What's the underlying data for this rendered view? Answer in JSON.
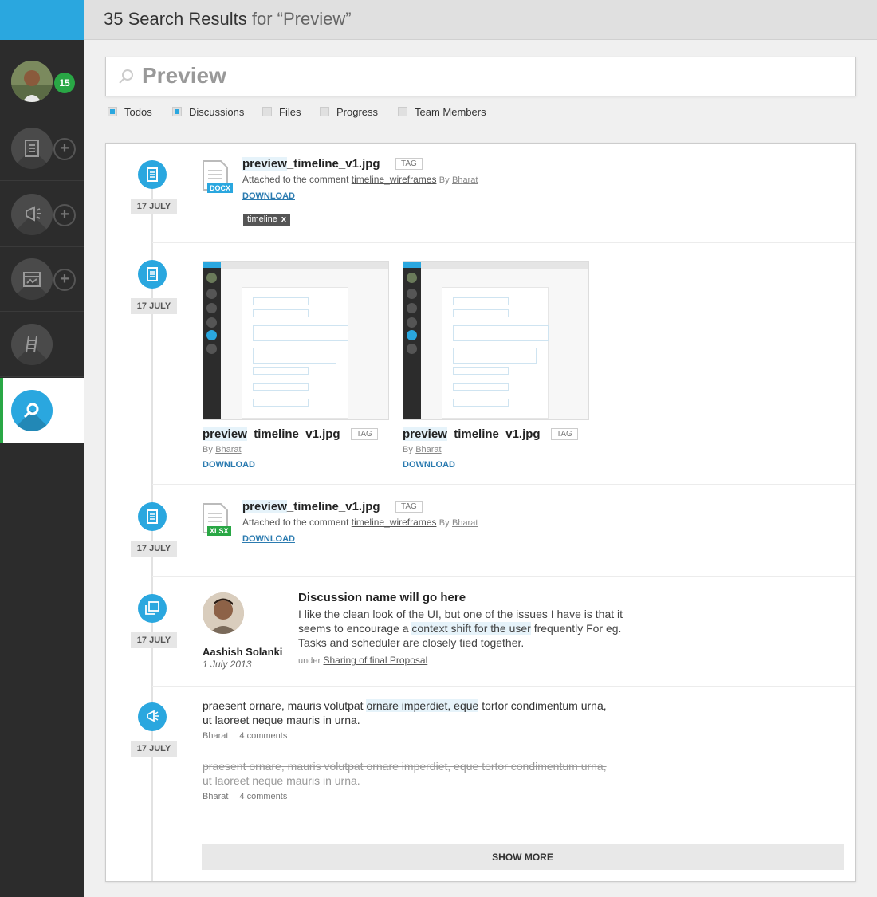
{
  "header": {
    "count_title": "35 Search Results",
    "query_suffix": "for “Preview”"
  },
  "nav": {
    "badge_count": "15"
  },
  "search": {
    "query": "Preview"
  },
  "filters": [
    {
      "label": "Todos",
      "checked": true
    },
    {
      "label": "Discussions",
      "checked": true
    },
    {
      "label": "Files",
      "checked": false
    },
    {
      "label": "Progress",
      "checked": false
    },
    {
      "label": "Team Members",
      "checked": false
    }
  ],
  "results": {
    "r1": {
      "date": "17 JULY",
      "file_name_hl": "preview",
      "file_name_rest": "_timeline_v1.jpg",
      "tag": "TAG",
      "attached_text": "Attached to the comment",
      "comment_link": "timeline_wireframes",
      "by": "By",
      "author": "Bharat",
      "download": "DOWNLOAD",
      "ext": "DOCX",
      "ext_color": "#2aa7df",
      "chip_label": "timeline",
      "chip_close": "x"
    },
    "r2": {
      "date": "17 JULY",
      "items": [
        {
          "file_name_hl": "preview",
          "file_name_rest": "_timeline_v1.jpg",
          "tag": "TAG",
          "by": "By",
          "author": "Bharat",
          "download": "DOWNLOAD"
        },
        {
          "file_name_hl": "preview",
          "file_name_rest": "_timeline_v1.jpg",
          "tag": "TAG",
          "by": "By",
          "author": "Bharat",
          "download": "DOWNLOAD"
        }
      ]
    },
    "r3": {
      "date": "17 JULY",
      "file_name_hl": "preview",
      "file_name_rest": "_timeline_v1.jpg",
      "tag": "TAG",
      "attached_text": "Attached to the comment",
      "comment_link": "timeline_wireframes",
      "by": "By",
      "author": "Bharat",
      "download": "DOWNLOAD",
      "ext": "XLSX",
      "ext_color": "#29a745"
    },
    "r4": {
      "date": "17 JULY",
      "author": "Aashish Solanki",
      "author_date": "1 July 2013",
      "title": "Discussion name will go here",
      "body_1": "I like the clean look of the UI, but one of the issues I have is that it seems to encourage a ",
      "body_hl": "context shift for the user",
      "body_2": " frequently For eg. Tasks and scheduler are closely tied together.",
      "under": "under",
      "under_link": "Sharing of final Proposal"
    },
    "r5": {
      "date": "17 JULY",
      "post1_a": "praesent ornare, mauris volutpat ",
      "post1_hl": "ornare imperdiet, eque",
      "post1_b": " tortor condimentum urna, ut laoreet neque mauris in urna.",
      "post1_author": "Bharat",
      "post1_comments": "4 comments",
      "post2": "praesent ornare, mauris volutpat ornare imperdiet, eque tortor condimentum urna, ut laoreet neque mauris in urna.",
      "post2_author": "Bharat",
      "post2_comments": "4 comments"
    }
  },
  "show_more": "SHOW MORE",
  "colors": {
    "accent": "#2aa7df",
    "success": "#29a745",
    "sidebar": "#2c2c2c"
  }
}
